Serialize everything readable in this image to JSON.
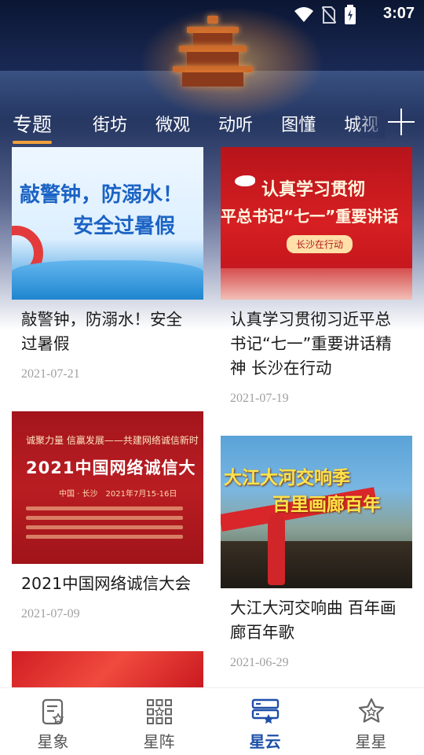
{
  "status_bar": {
    "time": "3:07",
    "icons": [
      "wifi-icon",
      "no-sim-icon",
      "battery-icon"
    ]
  },
  "tabs": [
    {
      "label": "专题",
      "active": true
    },
    {
      "label": "街坊",
      "active": false
    },
    {
      "label": "微观",
      "active": false
    },
    {
      "label": "动听",
      "active": false
    },
    {
      "label": "图懂",
      "active": false
    },
    {
      "label": "城视",
      "active": false
    }
  ],
  "cards": [
    {
      "title": "敲警钟，防溺水！安全过暑假",
      "date": "2021-07-21",
      "thumb_text": [
        "敲警钟，防溺水！",
        "安全过暑假"
      ]
    },
    {
      "title": "认真学习贯彻习近平总书记“七一”重要讲话精神 长沙在行动",
      "date": "2021-07-19",
      "thumb_text": [
        "认真学习贯彻",
        "平总书记“七一”重要讲话",
        "长沙在行动"
      ]
    },
    {
      "title": "2021中国网络诚信大会",
      "date": "2021-07-09",
      "thumb_text": [
        "诚聚力量 信赢发展——共建网络诚信新时",
        "2021中国网络诚信大",
        "中国 · 长沙　2021年7月15-16日"
      ]
    },
    {
      "title": "大江大河交响曲 百年画廊百年歌",
      "date": "2021-06-29",
      "thumb_text": [
        "大江大河交响季",
        "百里画廊百年"
      ]
    }
  ],
  "bottom_nav": [
    {
      "label": "星象",
      "icon": "document-star-icon",
      "active": false
    },
    {
      "label": "星阵",
      "icon": "grid-star-icon",
      "active": false
    },
    {
      "label": "星云",
      "icon": "server-star-icon",
      "active": true
    },
    {
      "label": "星星",
      "icon": "star-icon",
      "active": false
    }
  ],
  "colors": {
    "tab_indicator": "#f1a03a",
    "nav_active": "#1e4fa8",
    "nav_inactive": "#555555",
    "date": "#a0a0a0"
  }
}
